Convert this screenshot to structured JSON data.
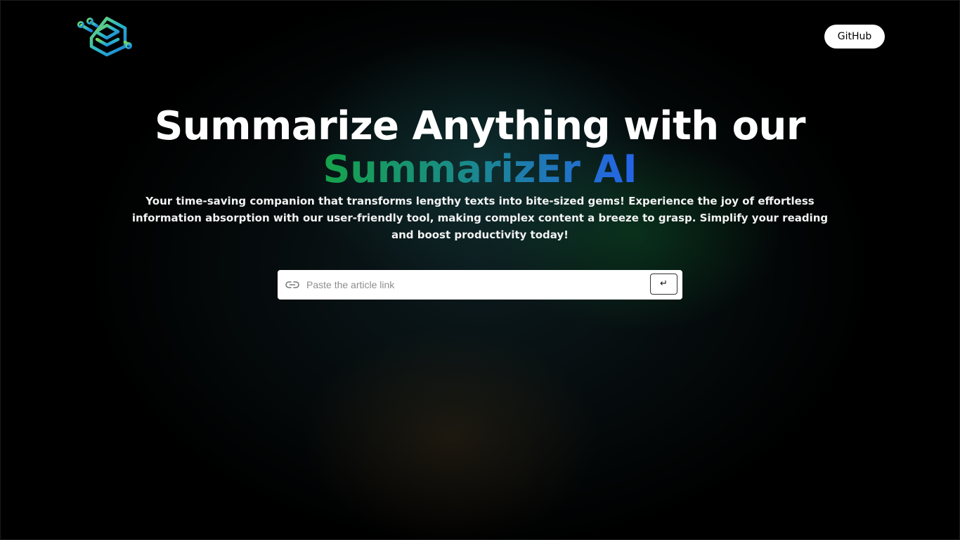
{
  "nav": {
    "logo_icon": "summarizer-logo-icon",
    "github_label": "GitHub"
  },
  "hero": {
    "title_line": "Summarize Anything with our",
    "brand_name": "SummarizEr AI",
    "tagline": "Your time-saving companion that transforms lengthy texts into bite-sized gems! Experience the joy of effortless information absorption with our user-friendly tool, making complex content a breeze to grasp. Simplify your reading and boost productivity today!"
  },
  "search": {
    "icon": "link-icon",
    "placeholder": "Paste the article link",
    "value": "",
    "submit_label": "↵"
  },
  "colors": {
    "brand_gradient_start": "#16a34a",
    "brand_gradient_mid": "#1a8a8a",
    "brand_gradient_end": "#2563eb",
    "background": "#000000"
  }
}
